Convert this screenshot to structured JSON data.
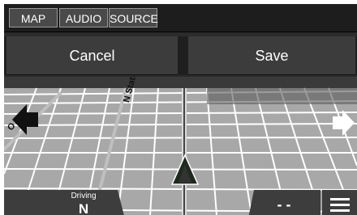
{
  "tabs": [
    {
      "label": "MAP"
    },
    {
      "label": "AUDIO"
    },
    {
      "label": "SOURCE"
    }
  ],
  "actions": {
    "cancel_label": "Cancel",
    "save_label": "Save"
  },
  "map": {
    "street_label_1": "N State St",
    "street_label_2": "O"
  },
  "status": {
    "mode_label": "Driving",
    "heading": "N",
    "distance": "- -"
  },
  "icons": {
    "left_arrow": "left-arrow-icon",
    "right_arrow": "right-arrow-icon",
    "vehicle": "vehicle-position-icon",
    "menu": "menu-icon"
  },
  "colors": {
    "tab_bg": "#4a4a4a",
    "button_bg": "#3c3c3c",
    "map_road": "#ffffff",
    "map_block": "#a0a0a0",
    "vehicle_fill": "#1f2a1f"
  }
}
